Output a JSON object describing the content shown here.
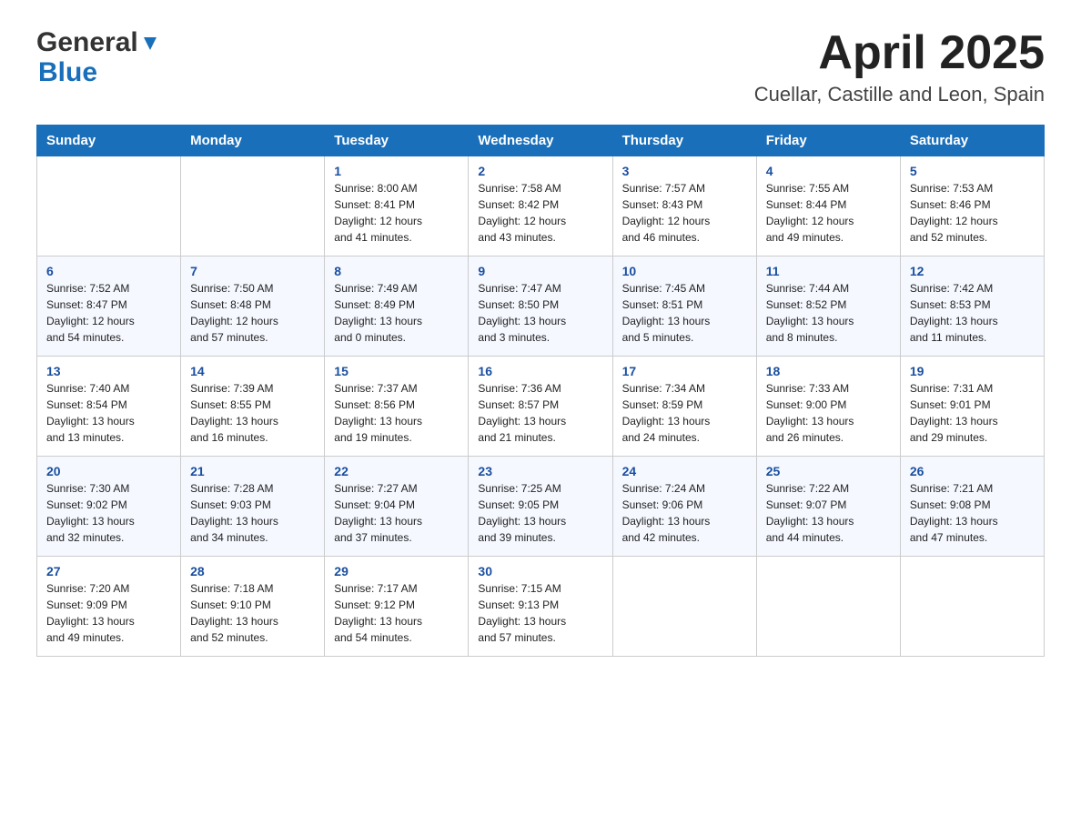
{
  "header": {
    "logo_general": "General",
    "logo_blue": "Blue",
    "month_title": "April 2025",
    "location": "Cuellar, Castille and Leon, Spain"
  },
  "days_of_week": [
    "Sunday",
    "Monday",
    "Tuesday",
    "Wednesday",
    "Thursday",
    "Friday",
    "Saturday"
  ],
  "weeks": [
    [
      {
        "day": "",
        "sunrise": "",
        "sunset": "",
        "daylight": ""
      },
      {
        "day": "",
        "sunrise": "",
        "sunset": "",
        "daylight": ""
      },
      {
        "day": "1",
        "sunrise": "Sunrise: 8:00 AM",
        "sunset": "Sunset: 8:41 PM",
        "daylight": "Daylight: 12 hours and 41 minutes."
      },
      {
        "day": "2",
        "sunrise": "Sunrise: 7:58 AM",
        "sunset": "Sunset: 8:42 PM",
        "daylight": "Daylight: 12 hours and 43 minutes."
      },
      {
        "day": "3",
        "sunrise": "Sunrise: 7:57 AM",
        "sunset": "Sunset: 8:43 PM",
        "daylight": "Daylight: 12 hours and 46 minutes."
      },
      {
        "day": "4",
        "sunrise": "Sunrise: 7:55 AM",
        "sunset": "Sunset: 8:44 PM",
        "daylight": "Daylight: 12 hours and 49 minutes."
      },
      {
        "day": "5",
        "sunrise": "Sunrise: 7:53 AM",
        "sunset": "Sunset: 8:46 PM",
        "daylight": "Daylight: 12 hours and 52 minutes."
      }
    ],
    [
      {
        "day": "6",
        "sunrise": "Sunrise: 7:52 AM",
        "sunset": "Sunset: 8:47 PM",
        "daylight": "Daylight: 12 hours and 54 minutes."
      },
      {
        "day": "7",
        "sunrise": "Sunrise: 7:50 AM",
        "sunset": "Sunset: 8:48 PM",
        "daylight": "Daylight: 12 hours and 57 minutes."
      },
      {
        "day": "8",
        "sunrise": "Sunrise: 7:49 AM",
        "sunset": "Sunset: 8:49 PM",
        "daylight": "Daylight: 13 hours and 0 minutes."
      },
      {
        "day": "9",
        "sunrise": "Sunrise: 7:47 AM",
        "sunset": "Sunset: 8:50 PM",
        "daylight": "Daylight: 13 hours and 3 minutes."
      },
      {
        "day": "10",
        "sunrise": "Sunrise: 7:45 AM",
        "sunset": "Sunset: 8:51 PM",
        "daylight": "Daylight: 13 hours and 5 minutes."
      },
      {
        "day": "11",
        "sunrise": "Sunrise: 7:44 AM",
        "sunset": "Sunset: 8:52 PM",
        "daylight": "Daylight: 13 hours and 8 minutes."
      },
      {
        "day": "12",
        "sunrise": "Sunrise: 7:42 AM",
        "sunset": "Sunset: 8:53 PM",
        "daylight": "Daylight: 13 hours and 11 minutes."
      }
    ],
    [
      {
        "day": "13",
        "sunrise": "Sunrise: 7:40 AM",
        "sunset": "Sunset: 8:54 PM",
        "daylight": "Daylight: 13 hours and 13 minutes."
      },
      {
        "day": "14",
        "sunrise": "Sunrise: 7:39 AM",
        "sunset": "Sunset: 8:55 PM",
        "daylight": "Daylight: 13 hours and 16 minutes."
      },
      {
        "day": "15",
        "sunrise": "Sunrise: 7:37 AM",
        "sunset": "Sunset: 8:56 PM",
        "daylight": "Daylight: 13 hours and 19 minutes."
      },
      {
        "day": "16",
        "sunrise": "Sunrise: 7:36 AM",
        "sunset": "Sunset: 8:57 PM",
        "daylight": "Daylight: 13 hours and 21 minutes."
      },
      {
        "day": "17",
        "sunrise": "Sunrise: 7:34 AM",
        "sunset": "Sunset: 8:59 PM",
        "daylight": "Daylight: 13 hours and 24 minutes."
      },
      {
        "day": "18",
        "sunrise": "Sunrise: 7:33 AM",
        "sunset": "Sunset: 9:00 PM",
        "daylight": "Daylight: 13 hours and 26 minutes."
      },
      {
        "day": "19",
        "sunrise": "Sunrise: 7:31 AM",
        "sunset": "Sunset: 9:01 PM",
        "daylight": "Daylight: 13 hours and 29 minutes."
      }
    ],
    [
      {
        "day": "20",
        "sunrise": "Sunrise: 7:30 AM",
        "sunset": "Sunset: 9:02 PM",
        "daylight": "Daylight: 13 hours and 32 minutes."
      },
      {
        "day": "21",
        "sunrise": "Sunrise: 7:28 AM",
        "sunset": "Sunset: 9:03 PM",
        "daylight": "Daylight: 13 hours and 34 minutes."
      },
      {
        "day": "22",
        "sunrise": "Sunrise: 7:27 AM",
        "sunset": "Sunset: 9:04 PM",
        "daylight": "Daylight: 13 hours and 37 minutes."
      },
      {
        "day": "23",
        "sunrise": "Sunrise: 7:25 AM",
        "sunset": "Sunset: 9:05 PM",
        "daylight": "Daylight: 13 hours and 39 minutes."
      },
      {
        "day": "24",
        "sunrise": "Sunrise: 7:24 AM",
        "sunset": "Sunset: 9:06 PM",
        "daylight": "Daylight: 13 hours and 42 minutes."
      },
      {
        "day": "25",
        "sunrise": "Sunrise: 7:22 AM",
        "sunset": "Sunset: 9:07 PM",
        "daylight": "Daylight: 13 hours and 44 minutes."
      },
      {
        "day": "26",
        "sunrise": "Sunrise: 7:21 AM",
        "sunset": "Sunset: 9:08 PM",
        "daylight": "Daylight: 13 hours and 47 minutes."
      }
    ],
    [
      {
        "day": "27",
        "sunrise": "Sunrise: 7:20 AM",
        "sunset": "Sunset: 9:09 PM",
        "daylight": "Daylight: 13 hours and 49 minutes."
      },
      {
        "day": "28",
        "sunrise": "Sunrise: 7:18 AM",
        "sunset": "Sunset: 9:10 PM",
        "daylight": "Daylight: 13 hours and 52 minutes."
      },
      {
        "day": "29",
        "sunrise": "Sunrise: 7:17 AM",
        "sunset": "Sunset: 9:12 PM",
        "daylight": "Daylight: 13 hours and 54 minutes."
      },
      {
        "day": "30",
        "sunrise": "Sunrise: 7:15 AM",
        "sunset": "Sunset: 9:13 PM",
        "daylight": "Daylight: 13 hours and 57 minutes."
      },
      {
        "day": "",
        "sunrise": "",
        "sunset": "",
        "daylight": ""
      },
      {
        "day": "",
        "sunrise": "",
        "sunset": "",
        "daylight": ""
      },
      {
        "day": "",
        "sunrise": "",
        "sunset": "",
        "daylight": ""
      }
    ]
  ]
}
